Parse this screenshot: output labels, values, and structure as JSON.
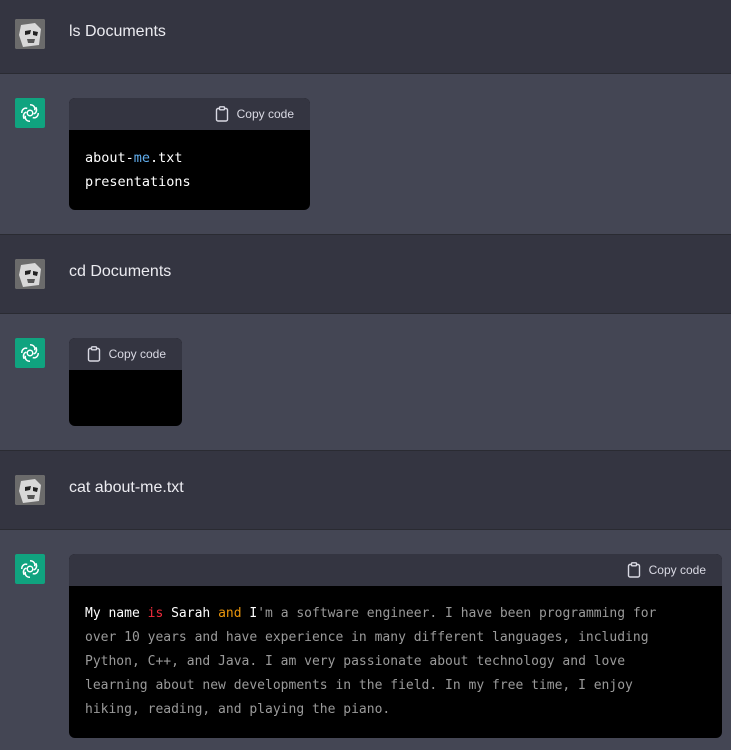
{
  "messages": [
    {
      "role": "user",
      "text": "ls Documents"
    },
    {
      "role": "assistant",
      "copy_label": "Copy code",
      "code_lines": [
        [
          "about-",
          "me",
          ".txt"
        ],
        [
          "presentations"
        ]
      ]
    },
    {
      "role": "user",
      "text": "cd Documents"
    },
    {
      "role": "assistant",
      "copy_label": "Copy code"
    },
    {
      "role": "user",
      "text": "cat about-me.txt"
    },
    {
      "role": "assistant",
      "copy_label": "Copy code",
      "code": {
        "seg1": "My name ",
        "seg2": "is",
        "seg3": " Sarah ",
        "seg4": "and",
        "seg5": " I",
        "seg6": "'m a software engineer. I have been programming for",
        "line2": "over 10 years and have experience in many different languages, including",
        "line3": "Python, C++, and Java. I am very passionate about technology and love",
        "line4": "learning about new developments in the field. In my free time, I enjoy",
        "line5": "hiking, reading, and playing the piano."
      }
    }
  ],
  "colors": {
    "user_bg": "#343541",
    "assistant_bg": "#444654",
    "gpt_green": "#10a37f"
  },
  "icons": {
    "user_avatar": "stormtrooper-avatar-icon",
    "assistant_avatar": "openai-logo-icon",
    "copy": "clipboard-icon"
  }
}
